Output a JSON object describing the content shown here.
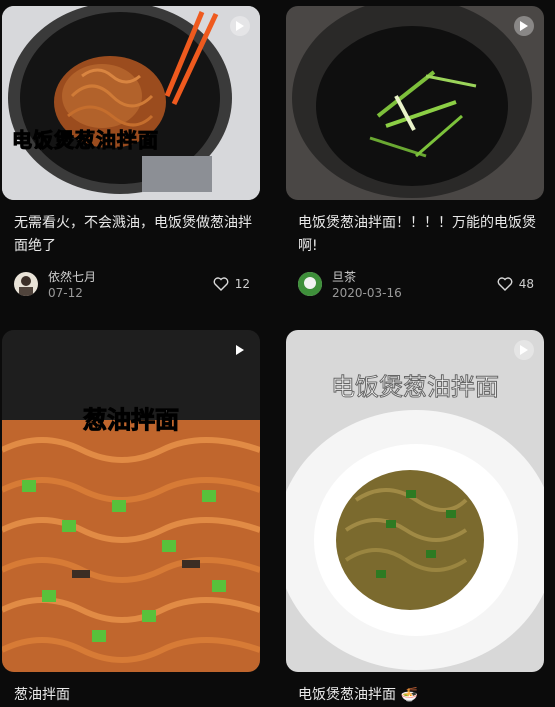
{
  "cards": [
    {
      "overlay": "电饭煲葱油拌面",
      "title": "无需看火，不会溅油，电饭煲做葱油拌面绝了",
      "user": "依然七月",
      "date": "07-12",
      "likes": "12"
    },
    {
      "overlay": "",
      "title": "电饭煲葱油拌面！！！！万能的电饭煲啊!",
      "user": "旦茶",
      "date": "2020-03-16",
      "likes": "48"
    },
    {
      "overlay": "葱油拌面",
      "title": "葱油拌面",
      "user": "",
      "date": "",
      "likes": ""
    },
    {
      "overlay": "电饭煲葱油拌面",
      "title": "电饭煲葱油拌面 🍜",
      "user": "",
      "date": "",
      "likes": ""
    }
  ],
  "icons": {
    "play": "play-icon",
    "heart": "heart-icon"
  },
  "colors": {
    "background": "#0b0b0b",
    "text": "#e9e9e9",
    "muted": "#9a9a9a",
    "overlay_yellow": "#f3d233"
  }
}
